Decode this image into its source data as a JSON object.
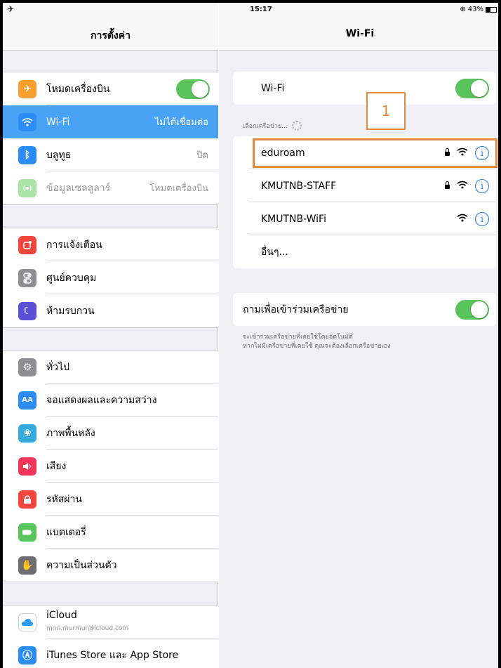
{
  "status_bar": {
    "time": "15:17",
    "battery": "43%"
  },
  "sidebar": {
    "title": "การตั้งค่า",
    "group1": [
      {
        "label": "โหมดเครื่องบิน",
        "icon": "airplane-icon",
        "color": "#f7a02f",
        "toggle": true
      },
      {
        "label": "Wi-Fi",
        "value": "ไม่ได้เชื่อมต่อ",
        "icon": "wifi-icon",
        "color": "#2b8cf6",
        "selected": true
      },
      {
        "label": "บลูทูธ",
        "value": "ปิด",
        "icon": "bluetooth-icon",
        "color": "#2b8cf6"
      },
      {
        "label": "ข้อมูลเซลลูลาร์",
        "value": "โหมดเครื่องบิน",
        "icon": "cellular-icon",
        "color": "#6fd36a",
        "dim": true
      }
    ],
    "group2": [
      {
        "label": "การแจ้งเตือน",
        "icon": "notifications-icon",
        "color": "#f2453d"
      },
      {
        "label": "ศูนย์ควบคุม",
        "icon": "control-center-icon",
        "color": "#8e8e93"
      },
      {
        "label": "ห้ามรบกวน",
        "icon": "moon-icon",
        "color": "#5b4fd6"
      }
    ],
    "group3": [
      {
        "label": "ทั่วไป",
        "icon": "gear-icon",
        "color": "#8e8e93"
      },
      {
        "label": "จอแสดงผลและความสว่าง",
        "icon": "display-icon",
        "color": "#2b8cf6"
      },
      {
        "label": "ภาพพื้นหลัง",
        "icon": "wallpaper-icon",
        "color": "#36aadc"
      },
      {
        "label": "เสียง",
        "icon": "sound-icon",
        "color": "#f2365a"
      },
      {
        "label": "รหัสผ่าน",
        "icon": "lock-icon",
        "color": "#f2453d"
      },
      {
        "label": "แบตเตอรี่",
        "icon": "battery-icon",
        "color": "#5ac35c"
      },
      {
        "label": "ความเป็นส่วนตัว",
        "icon": "hand-icon",
        "color": "#6d6d72"
      }
    ],
    "group4": [
      {
        "label": "iCloud",
        "sub": "mnn.murmur@icloud.com",
        "icon": "icloud-icon",
        "color": "#ffffff"
      },
      {
        "label": "iTunes Store และ App Store",
        "icon": "appstore-icon",
        "color": "#2b8cf6"
      }
    ]
  },
  "detail": {
    "title": "Wi-Fi",
    "wifi_row": {
      "label": "Wi-Fi",
      "toggle": true
    },
    "choose_network_header": "เลือกเครือข่าย...",
    "networks": [
      {
        "name": "eduroam",
        "locked": true
      },
      {
        "name": "KMUTNB-STAFF",
        "locked": true
      },
      {
        "name": "KMUTNB-WiFi",
        "locked": false
      }
    ],
    "other_label": "อื่นๆ...",
    "ask_join": {
      "label": "ถามเพื่อเข้าร่วมเครือข่าย",
      "toggle": true
    },
    "ask_note_line1": "จะเข้าร่วมเครือข่ายที่เคยใช้โดยอัตโนมัติ",
    "ask_note_line2": "หากไม่มีเครือข่ายที่เคยใช้ คุณจะต้องเลือกเครือข่ายเอง",
    "callout_number": "1",
    "highlight_color": "#e38a3e"
  }
}
